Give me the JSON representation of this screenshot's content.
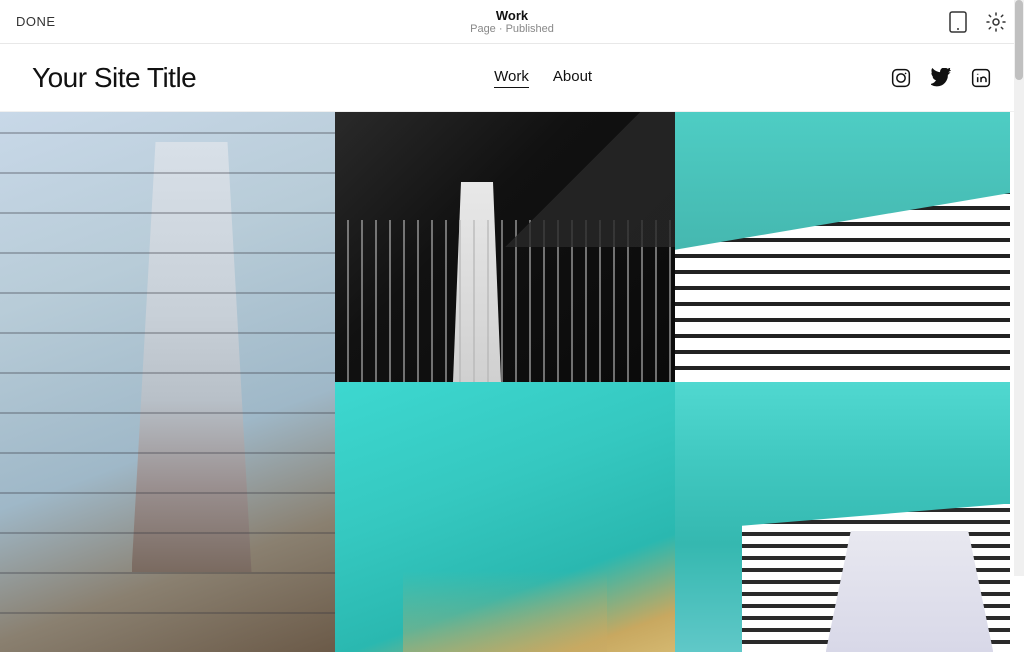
{
  "topbar": {
    "done_label": "DONE",
    "page_name": "Work",
    "page_status": "Page · Published",
    "mobile_icon": "mobile-icon",
    "settings_icon": "settings-icon"
  },
  "navbar": {
    "site_title": "Your Site Title",
    "nav_items": [
      {
        "label": "Work",
        "active": true
      },
      {
        "label": "About",
        "active": false
      }
    ],
    "social": [
      "instagram-icon",
      "twitter-icon",
      "linkedin-icon"
    ]
  },
  "grid": {
    "photos": [
      {
        "id": 1,
        "alt": "Angular white building with rust base against grey-blue sky"
      },
      {
        "id": 2,
        "alt": "Dark dramatic building with white tower and railings"
      },
      {
        "id": 3,
        "alt": "White striated building against teal sky"
      },
      {
        "id": 4,
        "alt": "Teal sky with hint of architectural structure"
      },
      {
        "id": 5,
        "alt": "White horizontally striped building against teal sky"
      }
    ]
  }
}
